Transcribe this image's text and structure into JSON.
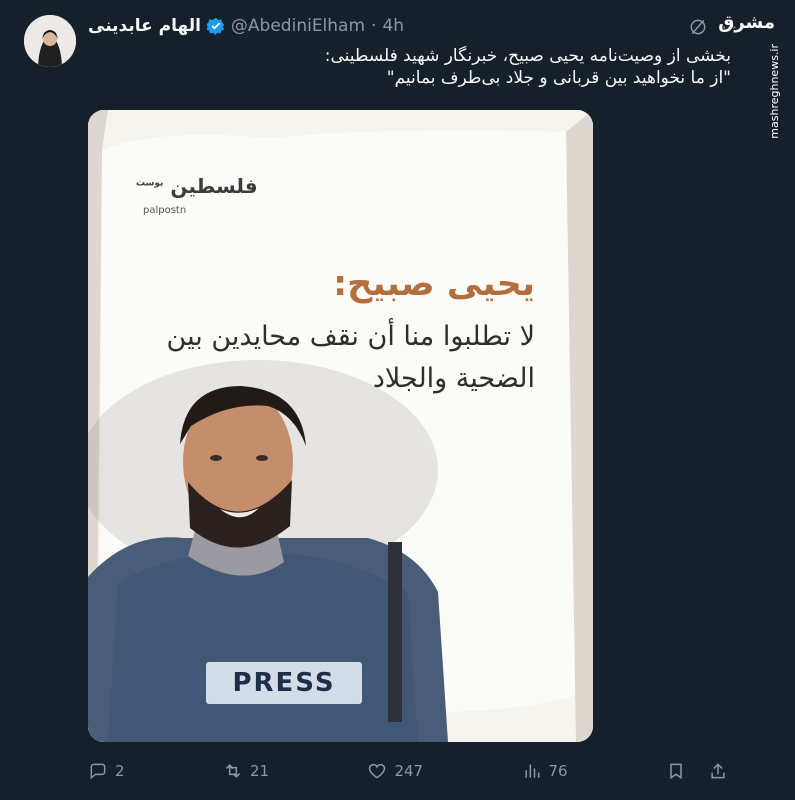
{
  "author": {
    "display_name": "الهام عابدینی",
    "handle": "@AbediniElham",
    "separator": "·",
    "time": "4h"
  },
  "top_icons": {
    "more": "···"
  },
  "watermark": {
    "logo": "مشرق",
    "url": "mashreghnews.ir"
  },
  "tweet": {
    "line1": "بخشی از وصیت‌نامه یحیی صبیح، خبرنگار شهید فلسطینی:",
    "line2": "\"از ما نخواهید بین قربانی و جلاد بی‌طرف بمانیم\""
  },
  "media": {
    "outlet_logo": "فلسطين",
    "outlet_sub": "بوست",
    "outlet_handle": "palpostn",
    "headline": "يحيى صبيح:",
    "quote": "لا تطلبوا منا أن نقف محايدين بين الضحية والجلاد",
    "vest_label": "PRESS"
  },
  "actions": {
    "replies": "2",
    "reposts": "21",
    "likes": "247",
    "views": "76"
  }
}
